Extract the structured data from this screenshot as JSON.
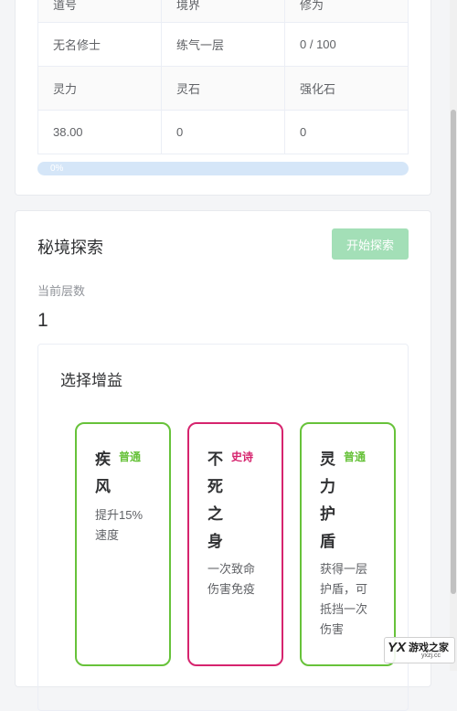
{
  "stats": {
    "header1": [
      "道号",
      "境界",
      "修为"
    ],
    "row1": [
      "无名修士",
      "练气一层",
      "0 / 100"
    ],
    "header2": [
      "灵力",
      "灵石",
      "强化石"
    ],
    "row2": [
      "38.00",
      "0",
      "0"
    ]
  },
  "progress": {
    "label": "0%",
    "percent": 0,
    "color": "#409eff"
  },
  "explore": {
    "title": "秘境探索",
    "start_button": "开始探索",
    "floor_label": "当前层数",
    "floor_value": "1"
  },
  "buff_panel": {
    "title": "选择增益",
    "cards": [
      {
        "name": [
          "疾",
          "风"
        ],
        "rarity": "普通",
        "description": [
          "提升15%",
          "速度"
        ]
      },
      {
        "name": [
          "不",
          "死",
          "之",
          "身"
        ],
        "rarity": "史诗",
        "description": [
          "一次致命",
          "伤害免疫"
        ]
      },
      {
        "name": [
          "灵",
          "力",
          "护",
          "盾"
        ],
        "rarity": "普通",
        "description": [
          "获得一层",
          "护盾，可",
          "抵挡一次",
          "伤害"
        ]
      }
    ]
  },
  "colors": {
    "common": "#67c23a",
    "epic": "#d6246e",
    "start_button": "#a3dfb7"
  },
  "watermark": {
    "mark": "YX",
    "name": "游戏之家",
    "url": "yxzj.cc"
  }
}
